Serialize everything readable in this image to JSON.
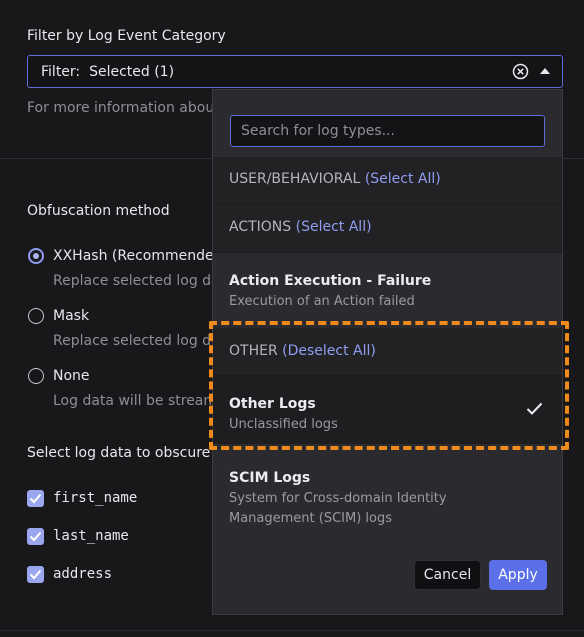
{
  "filter": {
    "label": "Filter by Log Event Category",
    "prefix": "Filter:",
    "value": "Selected (1)",
    "clear_icon": "clear-circle-icon",
    "caret_icon": "caret-up-icon",
    "help_text": "For more information about c"
  },
  "obfuscation": {
    "label": "Obfuscation method",
    "options": [
      {
        "label": "XXHash (Recommended",
        "desc": "Replace selected log da",
        "selected": true
      },
      {
        "label": "Mask",
        "desc": "Replace selected log da",
        "selected": false
      },
      {
        "label": "None",
        "desc": "Log data will be stream",
        "selected": false
      }
    ]
  },
  "obscure": {
    "label": "Select log data to obscure in",
    "fields": [
      {
        "name": "first_name",
        "checked": true
      },
      {
        "name": "last_name",
        "checked": true
      },
      {
        "name": "address",
        "checked": true
      }
    ]
  },
  "dropdown": {
    "search_placeholder": "Search for log types...",
    "groups": [
      {
        "title": "USER/BEHAVIORAL",
        "action": "(Select All)"
      },
      {
        "title": "ACTIONS",
        "action": "(Select All)"
      },
      {
        "title": "OTHER",
        "action": "(Deselect All)"
      }
    ],
    "items": [
      {
        "title": "Action Execution - Failure",
        "desc": "Execution of an Action failed",
        "selected": false
      },
      {
        "title": "Other Logs",
        "desc": "Unclassified logs",
        "selected": true
      },
      {
        "title": "SCIM Logs",
        "desc": "System for Cross-domain Identity",
        "desc2": "Management (SCIM) logs",
        "selected": false
      }
    ],
    "cancel_label": "Cancel",
    "apply_label": "Apply"
  },
  "colors": {
    "accent": "#5b70e8",
    "highlight": "#f08a1c",
    "background": "#18181a"
  }
}
